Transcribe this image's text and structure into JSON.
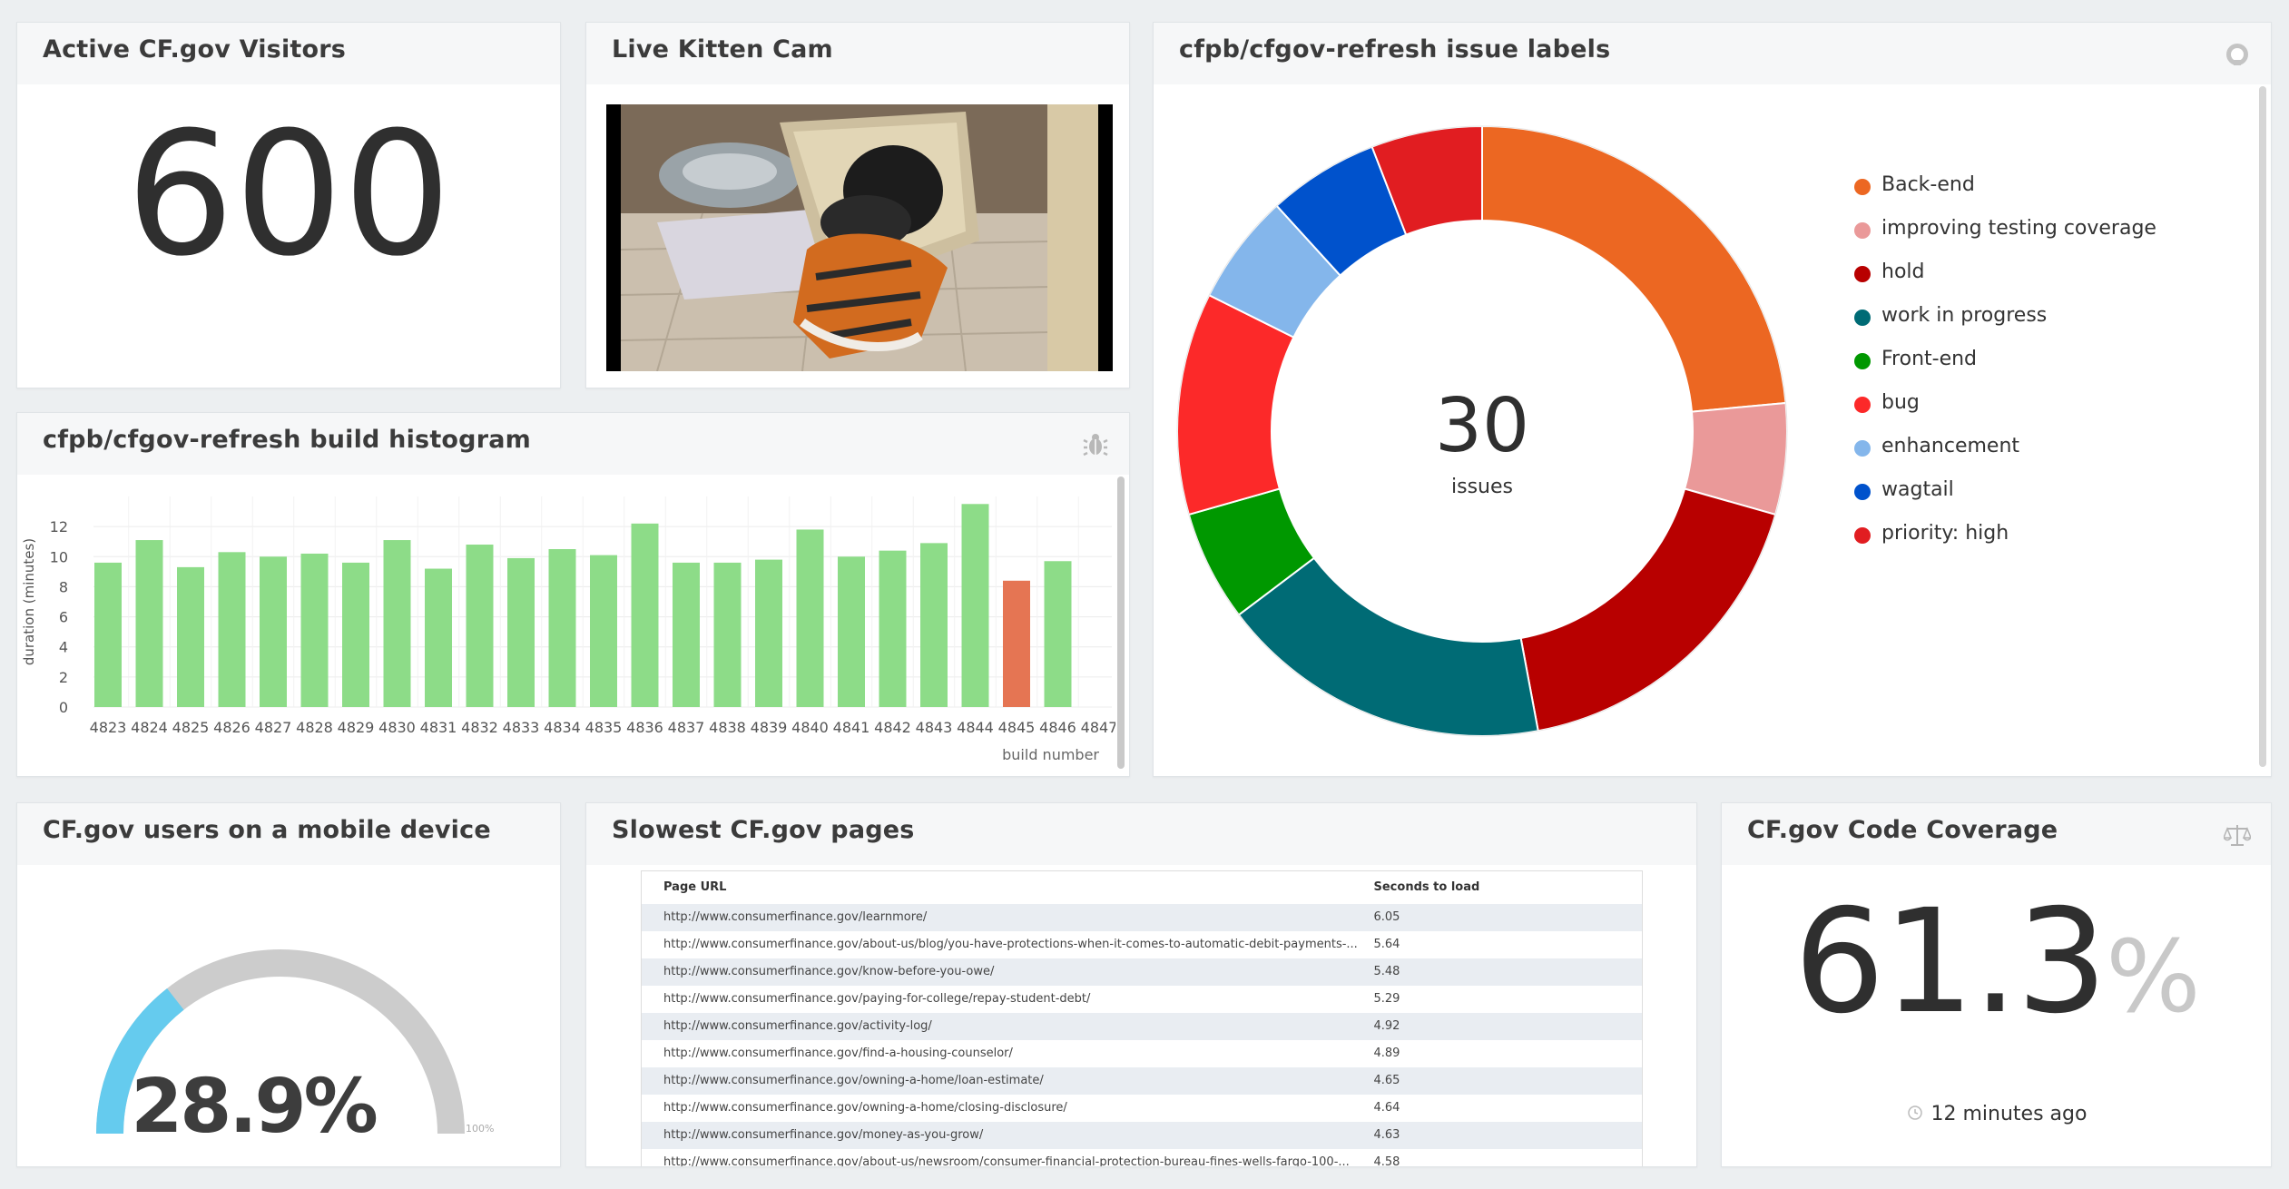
{
  "visitors": {
    "title": "Active CF.gov Visitors",
    "value": "600"
  },
  "kitten": {
    "title": "Live Kitten Cam"
  },
  "histogram": {
    "title": "cfpb/cfgov-refresh build histogram",
    "icon": "bug-icon"
  },
  "labels_widget": {
    "title": "cfpb/cfgov-refresh issue labels",
    "icon": "github-icon",
    "total": "30",
    "total_caption": "issues",
    "legend": [
      {
        "label": "Back-end",
        "count": "4",
        "color": "#ec6722"
      },
      {
        "label": "improving testing coverage",
        "count": "1",
        "color": "#ea9999"
      },
      {
        "label": "hold",
        "count": "3",
        "color": "#b80000"
      },
      {
        "label": "work in progress",
        "count": "3",
        "color": "#006b75"
      },
      {
        "label": "Front-end",
        "count": "1",
        "color": "#009800"
      },
      {
        "label": "bug",
        "count": "2",
        "color": "#fc2929"
      },
      {
        "label": "enhancement",
        "count": "1",
        "color": "#84b6eb"
      },
      {
        "label": "wagtail",
        "count": "1",
        "color": "#0052cc"
      },
      {
        "label": "priority: high",
        "count": "1",
        "color": "#e11d21"
      }
    ]
  },
  "mobile": {
    "title": "CF.gov users on a mobile device",
    "value": "28.9%",
    "max_label": "100%",
    "fraction": 0.289
  },
  "slowest": {
    "title": "Slowest CF.gov pages",
    "col_url": "Page URL",
    "col_seconds": "Seconds to load",
    "rows": [
      {
        "url": "http://www.consumerfinance.gov/learnmore/",
        "sec": "6.05"
      },
      {
        "url": "http://www.consumerfinance.gov/about-us/blog/you-have-protections-when-it-comes-to-automatic-debit-payments-...",
        "sec": "5.64"
      },
      {
        "url": "http://www.consumerfinance.gov/know-before-you-owe/",
        "sec": "5.48"
      },
      {
        "url": "http://www.consumerfinance.gov/paying-for-college/repay-student-debt/",
        "sec": "5.29"
      },
      {
        "url": "http://www.consumerfinance.gov/activity-log/",
        "sec": "4.92"
      },
      {
        "url": "http://www.consumerfinance.gov/find-a-housing-counselor/",
        "sec": "4.89"
      },
      {
        "url": "http://www.consumerfinance.gov/owning-a-home/loan-estimate/",
        "sec": "4.65"
      },
      {
        "url": "http://www.consumerfinance.gov/owning-a-home/closing-disclosure/",
        "sec": "4.64"
      },
      {
        "url": "http://www.consumerfinance.gov/money-as-you-grow/",
        "sec": "4.63"
      },
      {
        "url": "http://www.consumerfinance.gov/about-us/newsroom/consumer-financial-protection-bureau-fines-wells-fargo-100-...",
        "sec": "4.58"
      }
    ]
  },
  "coverage": {
    "title": "CF.gov Code Coverage",
    "value": "61.3",
    "unit": "%",
    "updated": "12 minutes ago",
    "icon": "balance-scale-icon"
  },
  "chart_data": [
    {
      "type": "bar",
      "categories": [
        "4823",
        "4824",
        "4825",
        "4826",
        "4827",
        "4828",
        "4829",
        "4830",
        "4831",
        "4832",
        "4833",
        "4834",
        "4835",
        "4836",
        "4837",
        "4838",
        "4839",
        "4840",
        "4841",
        "4842",
        "4843",
        "4844",
        "4845",
        "4846",
        "4847"
      ],
      "values": [
        9.6,
        11.1,
        9.3,
        10.3,
        10.0,
        10.2,
        9.6,
        11.1,
        9.2,
        10.8,
        9.9,
        10.5,
        10.1,
        12.2,
        9.6,
        9.6,
        9.8,
        11.8,
        10.0,
        10.4,
        10.9,
        13.5,
        8.4,
        9.7,
        null
      ],
      "bar_colors": [
        "#8ddc88",
        "#8ddc88",
        "#8ddc88",
        "#8ddc88",
        "#8ddc88",
        "#8ddc88",
        "#8ddc88",
        "#8ddc88",
        "#8ddc88",
        "#8ddc88",
        "#8ddc88",
        "#8ddc88",
        "#8ddc88",
        "#8ddc88",
        "#8ddc88",
        "#8ddc88",
        "#8ddc88",
        "#8ddc88",
        "#8ddc88",
        "#8ddc88",
        "#8ddc88",
        "#8ddc88",
        "#e57553",
        "#8ddc88",
        "#8ddc88"
      ],
      "ylabel": "duration (minutes)",
      "xlabel": "build number",
      "yticks": [
        "0",
        "2",
        "4",
        "6",
        "8",
        "10",
        "12"
      ],
      "ylim": [
        0,
        14
      ],
      "grid": true
    },
    {
      "type": "pie",
      "donut": true,
      "categories": [
        "Back-end",
        "improving testing coverage",
        "hold",
        "work in progress",
        "Front-end",
        "bug",
        "enhancement",
        "wagtail",
        "priority: high"
      ],
      "values": [
        4,
        1,
        3,
        3,
        1,
        2,
        1,
        1,
        1
      ],
      "colors": [
        "#ec6722",
        "#ea9999",
        "#b80000",
        "#006b75",
        "#009800",
        "#fc2929",
        "#84b6eb",
        "#0052cc",
        "#e11d21"
      ],
      "legend": "right"
    }
  ]
}
